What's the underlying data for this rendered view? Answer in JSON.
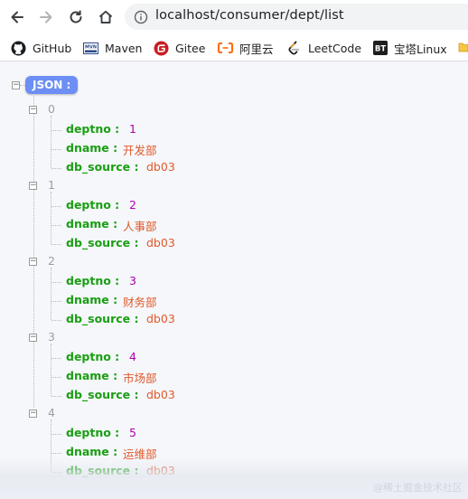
{
  "browser": {
    "url": "localhost/consumer/dept/list",
    "bookmarks": [
      {
        "label": "GitHub",
        "icon": "github-icon"
      },
      {
        "label": "Maven",
        "icon": "maven-icon"
      },
      {
        "label": "Gitee",
        "icon": "gitee-icon"
      },
      {
        "label": "阿里云",
        "icon": "aliyun-icon"
      },
      {
        "label": "LeetCode",
        "icon": "leetcode-icon"
      },
      {
        "label": "宝塔Linux",
        "icon": "bt-icon"
      }
    ]
  },
  "json_viewer": {
    "root_label": "JSON :",
    "items": [
      {
        "index": "0",
        "fields": [
          {
            "key": "deptno :",
            "value": "1",
            "kind": "number"
          },
          {
            "key": "dname :",
            "value": "开发部",
            "kind": "string"
          },
          {
            "key": "db_source :",
            "value": "db03",
            "kind": "string"
          }
        ]
      },
      {
        "index": "1",
        "fields": [
          {
            "key": "deptno :",
            "value": "2",
            "kind": "number"
          },
          {
            "key": "dname :",
            "value": "人事部",
            "kind": "string"
          },
          {
            "key": "db_source :",
            "value": "db03",
            "kind": "string"
          }
        ]
      },
      {
        "index": "2",
        "fields": [
          {
            "key": "deptno :",
            "value": "3",
            "kind": "number"
          },
          {
            "key": "dname :",
            "value": "财务部",
            "kind": "string"
          },
          {
            "key": "db_source :",
            "value": "db03",
            "kind": "string"
          }
        ]
      },
      {
        "index": "3",
        "fields": [
          {
            "key": "deptno :",
            "value": "4",
            "kind": "number"
          },
          {
            "key": "dname :",
            "value": "市场部",
            "kind": "string"
          },
          {
            "key": "db_source :",
            "value": "db03",
            "kind": "string"
          }
        ]
      },
      {
        "index": "4",
        "fields": [
          {
            "key": "deptno :",
            "value": "5",
            "kind": "number"
          },
          {
            "key": "dname :",
            "value": "运维部",
            "kind": "string"
          },
          {
            "key": "db_source :",
            "value": "db03",
            "kind": "string"
          }
        ]
      }
    ]
  },
  "watermark": "@稀土掘金技术社区",
  "colors": {
    "key": "#1a9e12",
    "number": "#b000b0",
    "string": "#e0592a",
    "root_badge": "#6c8ef5"
  }
}
